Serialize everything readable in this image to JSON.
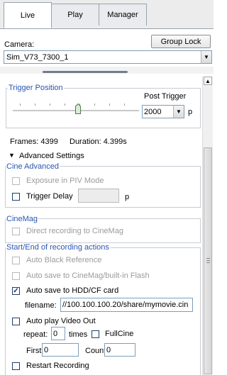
{
  "tabs": [
    {
      "label": "Live"
    },
    {
      "label": "Play"
    },
    {
      "label": "Manager"
    }
  ],
  "camera": {
    "label": "Camera:",
    "group_lock_label": "Group Lock",
    "selected": "Sim_V73_7300_1"
  },
  "trigger": {
    "group_label": "Trigger Position",
    "post_trigger_label": "Post Trigger",
    "post_trigger_value": "2000",
    "unit": "p"
  },
  "stats": {
    "frames": "Frames: 4399",
    "duration": "Duration: 4.399s"
  },
  "advanced": {
    "header": "Advanced Settings",
    "cine_advanced_label": "Cine Advanced",
    "exposure_piv": "Exposure in PIV Mode",
    "trigger_delay": "Trigger Delay",
    "trigger_delay_unit": "p",
    "cinemag_label": "CineMag",
    "direct_recording": "Direct recording to CineMag"
  },
  "actions": {
    "group_label": "Start/End of recording actions",
    "auto_black": "Auto Black Reference",
    "auto_save_cinemag": "Auto save to CineMag/built-in Flash",
    "auto_save_hdd": "Auto save to HDD/CF card",
    "filename_label": "filename:",
    "filename_value": "//100.100.100.20/share/mymovie.cin",
    "auto_play": "Auto play Video Out",
    "repeat_label": "repeat:",
    "repeat_value": "0",
    "times_label": "times",
    "fullcine_label": "FullCine",
    "first_label": "First",
    "first_value": "0",
    "count_label": "Count",
    "count_value": "0",
    "restart_recording": "Restart Recording",
    "auto_save_hdd_checked": true
  }
}
